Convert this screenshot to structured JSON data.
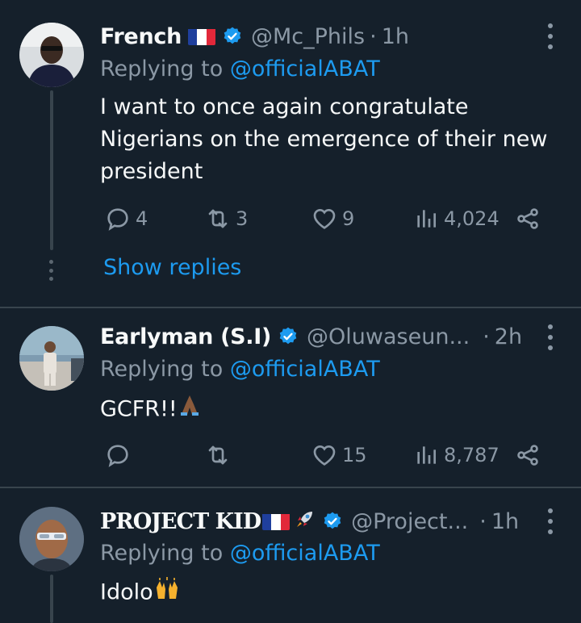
{
  "tweets": [
    {
      "name": "French",
      "handle": "@Mc_Phils",
      "dot": "·",
      "time": "1h",
      "replying_label": "Replying to",
      "replying_to": "@officialABAT",
      "text": "I want to once again congratulate Nigerians on the emergence of their new president",
      "replies": "4",
      "retweets": "3",
      "likes": "9",
      "views": "4,024",
      "show_replies": "Show replies"
    },
    {
      "name": "Earlyman (S.I)",
      "handle": "@Oluwaseun...",
      "dot": "·",
      "time": "2h",
      "replying_label": "Replying to",
      "replying_to": "@officialABAT",
      "text": "GCFR!!",
      "replies": "",
      "retweets": "",
      "likes": "15",
      "views": "8,787"
    },
    {
      "name": "PROJECT KID",
      "handle": "@Project...",
      "dot": "·",
      "time": "1h",
      "replying_label": "Replying to",
      "replying_to": "@officialABAT",
      "text": "Idolo"
    }
  ],
  "colors": {
    "background": "#15202b",
    "accent": "#1d9bf0",
    "muted": "#8b98a5",
    "divider": "#38444d"
  },
  "icons": [
    "reply-icon",
    "retweet-icon",
    "like-icon",
    "views-icon",
    "share-icon",
    "verified-badge-icon",
    "more-icon",
    "france-flag-icon",
    "rocket-icon",
    "folded-hands-icon",
    "raised-hands-icon"
  ]
}
